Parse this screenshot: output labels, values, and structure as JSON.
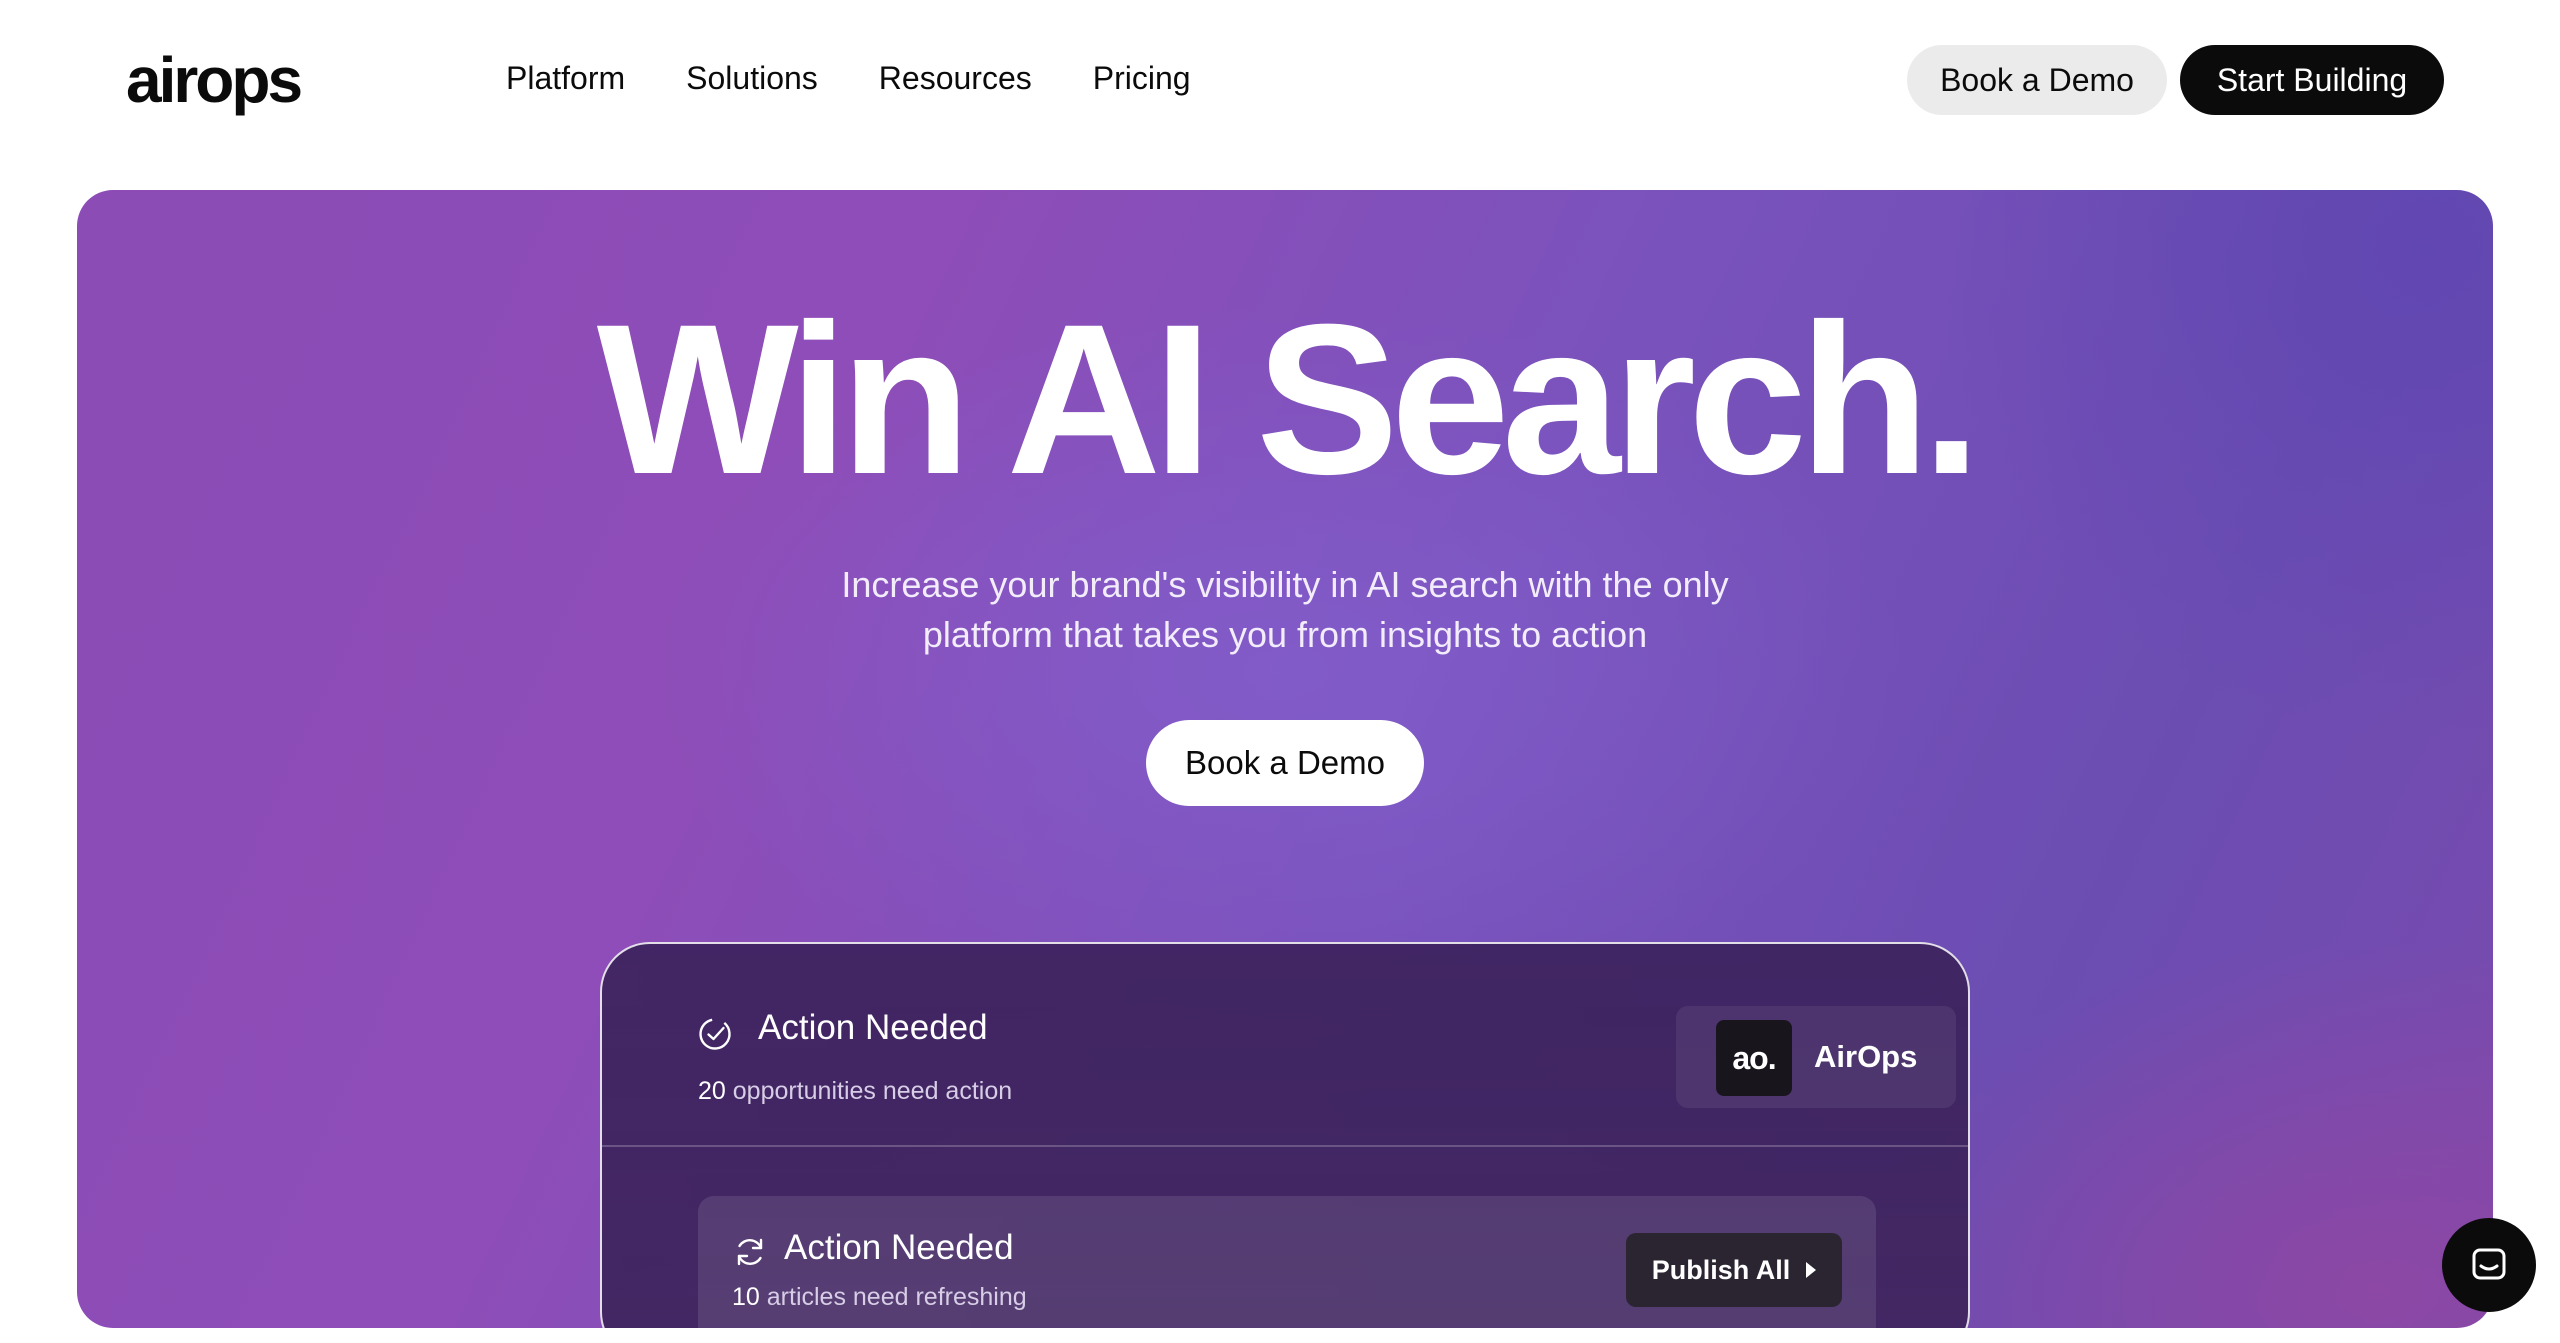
{
  "nav": {
    "logo": "airops",
    "links": [
      "Platform",
      "Solutions",
      "Resources",
      "Pricing"
    ],
    "book_demo_label": "Book a Demo",
    "start_building_label": "Start Building"
  },
  "hero": {
    "title": "Win AI Search.",
    "subtitle_line1": "Increase your brand's visibility in AI search with the only",
    "subtitle_line2": "platform that takes you from insights to action",
    "cta_label": "Book a Demo"
  },
  "panel": {
    "header": {
      "title": "Action Needed",
      "count": "20",
      "meta_text": "opportunities need action",
      "brand_logo_text": "ao.",
      "brand_name": "AirOps"
    },
    "card": {
      "title": "Action Needed",
      "count": "10",
      "meta_text": "articles need refreshing",
      "publish_label": "Publish All"
    }
  },
  "icons": {
    "check": "check-circle-icon",
    "refresh": "refresh-icon",
    "chat": "chat-icon",
    "caret": "caret-right-icon"
  },
  "colors": {
    "hero_purple": "#8b4cb6",
    "panel_bg": "#3c225c",
    "primary_black": "#0b0b0c",
    "secondary_gray": "#ebebec"
  }
}
